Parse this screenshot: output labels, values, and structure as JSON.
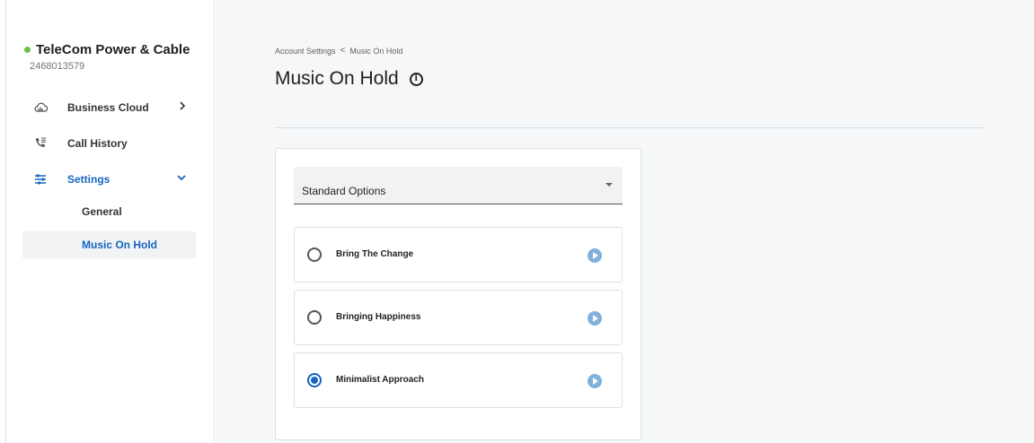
{
  "org": {
    "name": "TeleCom Power & Cable",
    "number": "2468013579"
  },
  "sidebar": {
    "items": [
      {
        "label": "Business Cloud",
        "icon": "cloud-icon"
      },
      {
        "label": "Call History",
        "icon": "phone-log-icon"
      },
      {
        "label": "Settings",
        "icon": "settings-sliders-icon"
      }
    ],
    "sub_items": [
      {
        "label": "General"
      },
      {
        "label": "Music On Hold"
      }
    ]
  },
  "breadcrumb": {
    "parent": "Account Settings",
    "separator": "<",
    "current": "Music On Hold"
  },
  "page": {
    "title": "Music On Hold"
  },
  "select": {
    "value": "Standard Options"
  },
  "options": [
    {
      "label": "Bring The Change",
      "selected": false
    },
    {
      "label": "Bringing Happiness",
      "selected": false
    },
    {
      "label": "Minimalist Approach",
      "selected": true
    }
  ],
  "colors": {
    "accent": "#1565c0",
    "status": "#6cc04a",
    "play": "#7fb1dc"
  }
}
